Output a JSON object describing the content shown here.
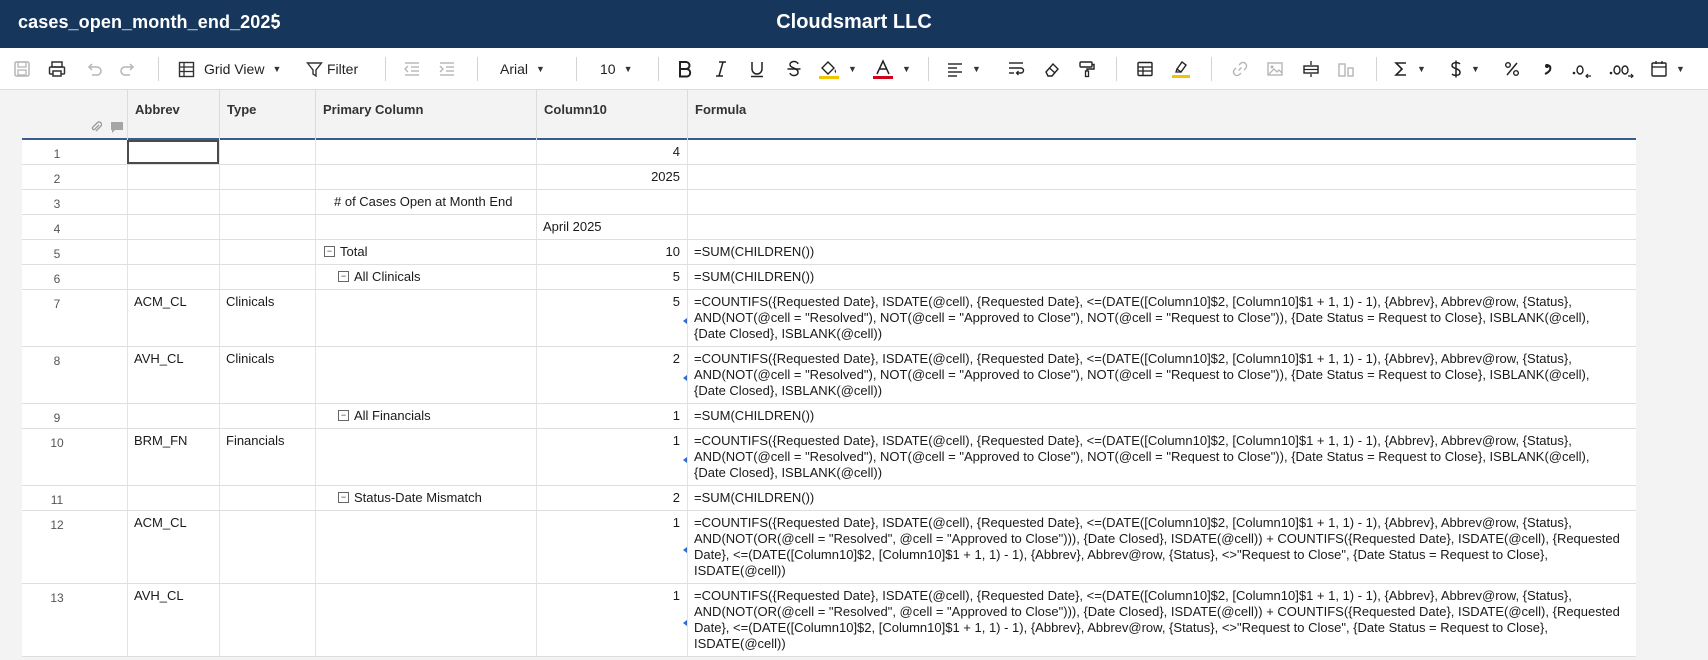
{
  "app": {
    "sheet_name": "cases_open_month_end_2025",
    "sheet_menu_glyph": "⋮",
    "org_name": "Cloudsmart LLC"
  },
  "toolbar": {
    "view_label": "Grid View",
    "filter_label": "Filter",
    "font_family": "Arial",
    "font_size": "10",
    "caret": "▼"
  },
  "columns": {
    "abbrev": "Abbrev",
    "type": "Type",
    "primary": "Primary Column",
    "column10": "Column10",
    "formula": "Formula"
  },
  "collapse_glyph": "−",
  "rows": [
    {
      "num": "1",
      "abbrev": "",
      "type": "",
      "primary": "",
      "column10": "4",
      "formula": ""
    },
    {
      "num": "2",
      "abbrev": "",
      "type": "",
      "primary": "",
      "column10": "2025",
      "formula": ""
    },
    {
      "num": "3",
      "abbrev": "",
      "type": "",
      "primary": "# of Cases Open at Month End",
      "column10": "",
      "formula": ""
    },
    {
      "num": "4",
      "abbrev": "",
      "type": "",
      "primary": "",
      "column10": "April 2025",
      "formula": ""
    },
    {
      "num": "5",
      "abbrev": "",
      "type": "",
      "primary": "Total",
      "column10": "10",
      "formula": "=SUM(CHILDREN())"
    },
    {
      "num": "6",
      "abbrev": "",
      "type": "",
      "primary": "All Clinicals",
      "column10": "5",
      "formula": "=SUM(CHILDREN())"
    },
    {
      "num": "7",
      "abbrev": "ACM_CL",
      "type": "Clinicals",
      "primary": "",
      "column10": "5",
      "formula": "=COUNTIFS({Requested Date}, ISDATE(@cell), {Requested Date}, <=(DATE([Column10]$2, [Column10]$1 + 1, 1) - 1), {Abbrev}, Abbrev@row, {Status}, AND(NOT(@cell = \"Resolved\"), NOT(@cell = \"Approved to Close\"), NOT(@cell = \"Request to Close\")), {Date Status = Request to Close}, ISBLANK(@cell), {Date Closed}, ISBLANK(@cell))"
    },
    {
      "num": "8",
      "abbrev": "AVH_CL",
      "type": "Clinicals",
      "primary": "",
      "column10": "2",
      "formula": "=COUNTIFS({Requested Date}, ISDATE(@cell), {Requested Date}, <=(DATE([Column10]$2, [Column10]$1 + 1, 1) - 1), {Abbrev}, Abbrev@row, {Status}, AND(NOT(@cell = \"Resolved\"), NOT(@cell = \"Approved to Close\"), NOT(@cell = \"Request to Close\")), {Date Status = Request to Close}, ISBLANK(@cell), {Date Closed}, ISBLANK(@cell))"
    },
    {
      "num": "9",
      "abbrev": "",
      "type": "",
      "primary": "All Financials",
      "column10": "1",
      "formula": "=SUM(CHILDREN())"
    },
    {
      "num": "10",
      "abbrev": "BRM_FN",
      "type": "Financials",
      "primary": "",
      "column10": "1",
      "formula": "=COUNTIFS({Requested Date}, ISDATE(@cell), {Requested Date}, <=(DATE([Column10]$2, [Column10]$1 + 1, 1) - 1), {Abbrev}, Abbrev@row, {Status}, AND(NOT(@cell = \"Resolved\"), NOT(@cell = \"Approved to Close\"), NOT(@cell = \"Request to Close\")), {Date Status = Request to Close}, ISBLANK(@cell), {Date Closed}, ISBLANK(@cell))"
    },
    {
      "num": "11",
      "abbrev": "",
      "type": "",
      "primary": "Status-Date Mismatch",
      "column10": "2",
      "formula": "=SUM(CHILDREN())"
    },
    {
      "num": "12",
      "abbrev": "ACM_CL",
      "type": "",
      "primary": "",
      "column10": "1",
      "formula": "=COUNTIFS({Requested Date}, ISDATE(@cell), {Requested Date}, <=(DATE([Column10]$2, [Column10]$1 + 1, 1) - 1), {Abbrev}, Abbrev@row, {Status}, AND(NOT(OR(@cell = \"Resolved\", @cell = \"Approved to Close\"))), {Date Closed}, ISDATE(@cell)) + COUNTIFS({Requested Date}, ISDATE(@cell), {Requested Date}, <=(DATE([Column10]$2, [Column10]$1 + 1, 1) - 1), {Abbrev}, Abbrev@row, {Status}, <>\"Request to Close\", {Date Status = Request to Close}, ISDATE(@cell))"
    },
    {
      "num": "13",
      "abbrev": "AVH_CL",
      "type": "",
      "primary": "",
      "column10": "1",
      "formula": "=COUNTIFS({Requested Date}, ISDATE(@cell), {Requested Date}, <=(DATE([Column10]$2, [Column10]$1 + 1, 1) - 1), {Abbrev}, Abbrev@row, {Status}, AND(NOT(OR(@cell = \"Resolved\", @cell = \"Approved to Close\"))), {Date Closed}, ISDATE(@cell)) + COUNTIFS({Requested Date}, ISDATE(@cell), {Requested Date}, <=(DATE([Column10]$2, [Column10]$1 + 1, 1) - 1), {Abbrev}, Abbrev@row, {Status}, <>\"Request to Close\", {Date Status = Request to Close}, ISDATE(@cell))"
    }
  ]
}
